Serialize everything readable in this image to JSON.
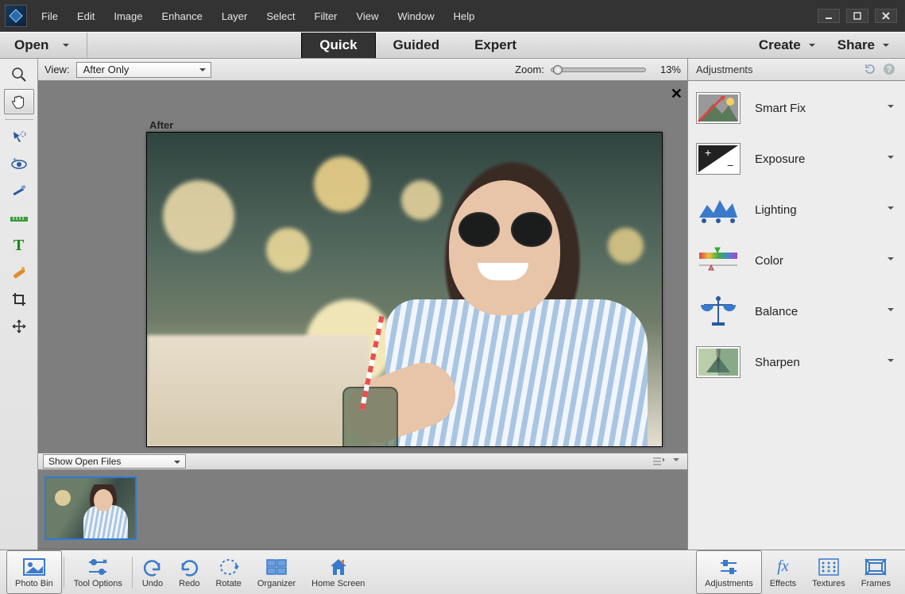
{
  "menu": {
    "items": [
      "File",
      "Edit",
      "Image",
      "Enhance",
      "Layer",
      "Select",
      "Filter",
      "View",
      "Window",
      "Help"
    ]
  },
  "modebar": {
    "open": "Open",
    "modes": [
      "Quick",
      "Guided",
      "Expert"
    ],
    "active": 0,
    "create": "Create",
    "share": "Share"
  },
  "options": {
    "view_label": "View:",
    "view_value": "After Only",
    "zoom_label": "Zoom:",
    "zoom_value": "13%"
  },
  "canvas": {
    "after_label": "After"
  },
  "photobin": {
    "selector": "Show Open Files"
  },
  "adjustments": {
    "title": "Adjustments",
    "items": [
      {
        "label": "Smart Fix",
        "icon": "smartfix"
      },
      {
        "label": "Exposure",
        "icon": "exposure"
      },
      {
        "label": "Lighting",
        "icon": "lighting"
      },
      {
        "label": "Color",
        "icon": "color"
      },
      {
        "label": "Balance",
        "icon": "balance"
      },
      {
        "label": "Sharpen",
        "icon": "sharpen"
      }
    ]
  },
  "bottom": {
    "left": [
      {
        "label": "Photo Bin",
        "icon": "photo",
        "selected": true
      },
      {
        "label": "Tool Options",
        "icon": "tooloptions"
      }
    ],
    "mid": [
      {
        "label": "Undo",
        "icon": "undo"
      },
      {
        "label": "Redo",
        "icon": "redo"
      },
      {
        "label": "Rotate",
        "icon": "rotate"
      },
      {
        "label": "Organizer",
        "icon": "organizer"
      },
      {
        "label": "Home Screen",
        "icon": "home"
      }
    ],
    "right": [
      {
        "label": "Adjustments",
        "icon": "adjusticon",
        "selected": true
      },
      {
        "label": "Effects",
        "icon": "fx"
      },
      {
        "label": "Textures",
        "icon": "textures"
      },
      {
        "label": "Frames",
        "icon": "frames"
      }
    ]
  },
  "tools": [
    {
      "name": "zoom-tool"
    },
    {
      "name": "hand-tool",
      "selected": true
    },
    {
      "sep": true
    },
    {
      "name": "quick-select-tool"
    },
    {
      "name": "eye-tool"
    },
    {
      "name": "whiten-tool"
    },
    {
      "name": "straighten-tool"
    },
    {
      "name": "type-tool"
    },
    {
      "name": "spot-heal-tool"
    },
    {
      "name": "crop-tool"
    },
    {
      "name": "move-tool"
    }
  ]
}
